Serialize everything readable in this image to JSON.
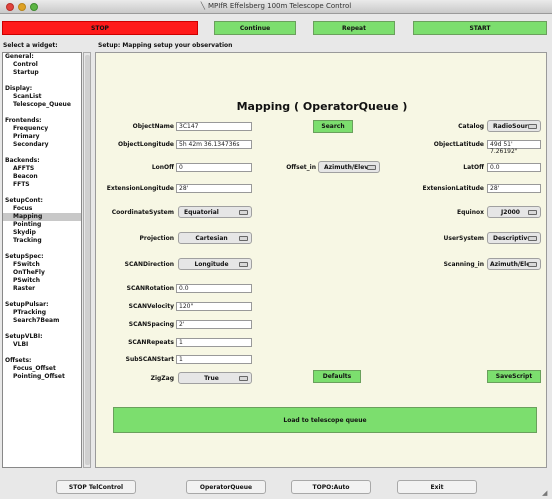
{
  "window": {
    "title": "MPIfR Effelsberg 100m Telescope Control"
  },
  "top_buttons": {
    "stop": "STOP",
    "continue": "Continue",
    "repeat": "Repeat",
    "start": "START"
  },
  "header": {
    "select_widget": "Select a widget:",
    "setup_line": "Setup: Mapping  setup your observation"
  },
  "sidebar": {
    "groups": [
      {
        "title": "General:",
        "items": [
          "Control",
          "Startup"
        ]
      },
      {
        "title": "Display:",
        "items": [
          "ScanList",
          "Telescope_Queue"
        ]
      },
      {
        "title": "Frontends:",
        "items": [
          "Frequency",
          "Primary",
          "Secondary"
        ]
      },
      {
        "title": "Backends:",
        "items": [
          "AFFTS",
          "Beacon",
          "FFTS"
        ]
      },
      {
        "title": "SetupCont:",
        "items": [
          "Focus",
          "Mapping",
          "Pointing",
          "Skydip",
          "Tracking"
        ]
      },
      {
        "title": "SetupSpec:",
        "items": [
          "FSwitch",
          "OnTheFly",
          "PSwitch",
          "Raster"
        ]
      },
      {
        "title": "SetupPulsar:",
        "items": [
          "PTracking",
          "Search7Beam"
        ]
      },
      {
        "title": "SetupVLBI:",
        "items": [
          "VLBI"
        ]
      },
      {
        "title": "Offsets:",
        "items": [
          "Focus_Offset",
          "Pointing_Offset"
        ]
      }
    ],
    "selected": "Mapping"
  },
  "panel": {
    "title": "Mapping ( OperatorQueue )",
    "object_name": {
      "label": "ObjectName",
      "value": "3C147"
    },
    "search_button": "Search",
    "catalog": {
      "label": "Catalog",
      "value": "RadioSources"
    },
    "object_longitude": {
      "label": "ObjectLongitude",
      "value": "5h 42m 36.134736s"
    },
    "object_latitude": {
      "label": "ObjectLatitude",
      "value": "49d 51' 7.26192\""
    },
    "lon_off": {
      "label": "LonOff",
      "value": "0"
    },
    "offset_in": {
      "label": "Offset_in",
      "value": "Azimuth/Elevation"
    },
    "lat_off": {
      "label": "LatOff",
      "value": "0.0"
    },
    "extension_longitude": {
      "label": "ExtensionLongitude",
      "value": "28'"
    },
    "extension_latitude": {
      "label": "ExtensionLatitude",
      "value": "28'"
    },
    "coordinate_system": {
      "label": "CoordinateSystem",
      "value": "Equatorial"
    },
    "equinox": {
      "label": "Equinox",
      "value": "J2000"
    },
    "projection": {
      "label": "Projection",
      "value": "Cartesian"
    },
    "user_system": {
      "label": "UserSystem",
      "value": "Descriptive"
    },
    "scan_direction": {
      "label": "SCANDirection",
      "value": "Longitude"
    },
    "scanning_in": {
      "label": "Scanning_in",
      "value": "Azimuth/Elevation"
    },
    "scan_rotation": {
      "label": "SCANRotation",
      "value": "0.0"
    },
    "scan_velocity": {
      "label": "SCANVelocity",
      "value": "120\""
    },
    "scan_spacing": {
      "label": "SCANSpacing",
      "value": "2'"
    },
    "scan_repeats": {
      "label": "SCANRepeats",
      "value": "1"
    },
    "subscan_start": {
      "label": "SubSCANStart",
      "value": "1"
    },
    "zigzag": {
      "label": "ZigZag",
      "value": "True"
    },
    "defaults_button": "Defaults",
    "save_script_button": "SaveScript",
    "load_button": "Load to telescope queue"
  },
  "bottom_buttons": {
    "stop_telcontrol": "STOP TelControl",
    "operator_queue": "OperatorQueue",
    "topo_auto": "TOPO:Auto",
    "exit": "Exit"
  },
  "colors": {
    "stop": "#ff1a1a",
    "green": "#7cde6e",
    "panel_bg": "#f7f7e4"
  }
}
